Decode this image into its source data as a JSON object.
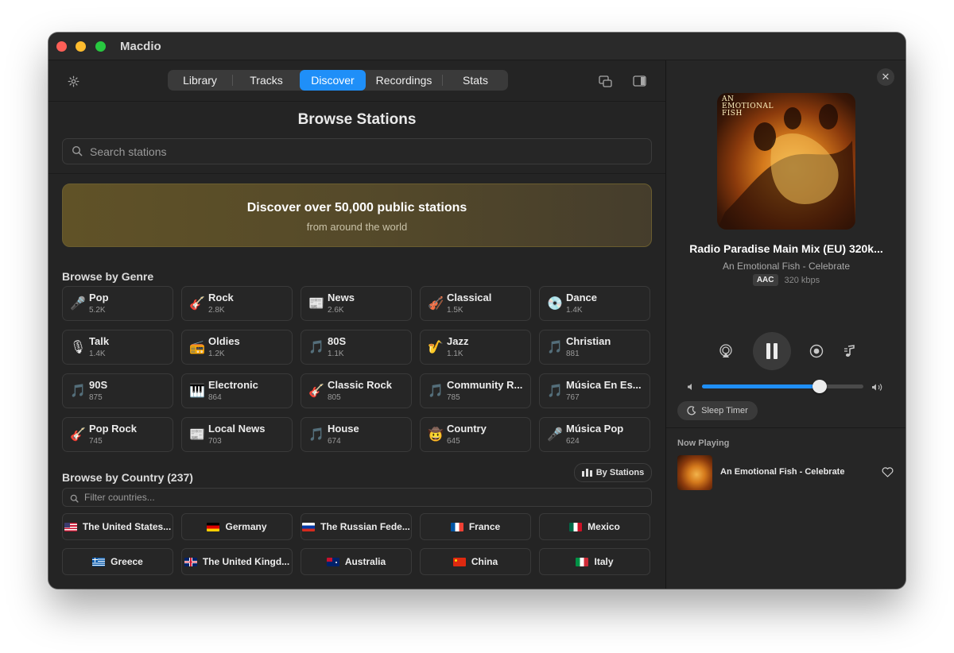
{
  "app": {
    "title": "Macdio"
  },
  "toolbar": {
    "tabs": [
      {
        "label": "Library",
        "active": false
      },
      {
        "label": "Tracks",
        "active": false
      },
      {
        "label": "Discover",
        "active": true
      },
      {
        "label": "Recordings",
        "active": false
      },
      {
        "label": "Stats",
        "active": false
      }
    ],
    "icons": {
      "settings": "gear-icon",
      "miniplayer": "mini-player-icon",
      "sidebar": "sidebar-toggle-icon"
    }
  },
  "browse": {
    "heading": "Browse Stations",
    "search_placeholder": "Search stations",
    "banner": {
      "title": "Discover over 50,000 public stations",
      "subtitle": "from around the world"
    }
  },
  "genres": {
    "title": "Browse by Genre",
    "items": [
      {
        "name": "Pop",
        "count": "5.2K",
        "icon": "🎤"
      },
      {
        "name": "Rock",
        "count": "2.8K",
        "icon": "🎸"
      },
      {
        "name": "News",
        "count": "2.6K",
        "icon": "📰"
      },
      {
        "name": "Classical",
        "count": "1.5K",
        "icon": "🎻"
      },
      {
        "name": "Dance",
        "count": "1.4K",
        "icon": "💿"
      },
      {
        "name": "Talk",
        "count": "1.4K",
        "icon": "🎙"
      },
      {
        "name": "Oldies",
        "count": "1.2K",
        "icon": "📻"
      },
      {
        "name": "80S",
        "count": "1.1K",
        "icon": "🎵"
      },
      {
        "name": "Jazz",
        "count": "1.1K",
        "icon": "🎷"
      },
      {
        "name": "Christian",
        "count": "881",
        "icon": "🎵"
      },
      {
        "name": "90S",
        "count": "875",
        "icon": "🎵"
      },
      {
        "name": "Electronic",
        "count": "864",
        "icon": "🎹"
      },
      {
        "name": "Classic Rock",
        "count": "805",
        "icon": "🎸"
      },
      {
        "name": "Community R...",
        "count": "785",
        "icon": "🎵"
      },
      {
        "name": "Música En Es...",
        "count": "767",
        "icon": "🎵"
      },
      {
        "name": "Pop Rock",
        "count": "745",
        "icon": "🎸"
      },
      {
        "name": "Local News",
        "count": "703",
        "icon": "📰"
      },
      {
        "name": "House",
        "count": "674",
        "icon": "🎵"
      },
      {
        "name": "Country",
        "count": "645",
        "icon": "🤠"
      },
      {
        "name": "Música Pop",
        "count": "624",
        "icon": "🎤"
      }
    ]
  },
  "countries": {
    "title": "Browse by Country (237)",
    "sort_label": "By Stations",
    "filter_placeholder": "Filter countries...",
    "items": [
      {
        "name": "The United States...",
        "flag": "us"
      },
      {
        "name": "Germany",
        "flag": "de"
      },
      {
        "name": "The Russian Fede...",
        "flag": "ru"
      },
      {
        "name": "France",
        "flag": "fr"
      },
      {
        "name": "Mexico",
        "flag": "mx"
      },
      {
        "name": "Greece",
        "flag": "gr"
      },
      {
        "name": "The United Kingd...",
        "flag": "gb"
      },
      {
        "name": "Australia",
        "flag": "au"
      },
      {
        "name": "China",
        "flag": "cn"
      },
      {
        "name": "Italy",
        "flag": "it"
      }
    ]
  },
  "player": {
    "station": "Radio Paradise Main Mix (EU) 320k...",
    "track": "An Emotional Fish - Celebrate",
    "codec": "AAC",
    "bitrate": "320 kbps",
    "album_art_text": "AN EMOTIONAL FISH",
    "volume": 0.73,
    "sleep_timer_label": "Sleep Timer",
    "now_playing_title": "Now Playing",
    "now_playing_item": "An Emotional Fish - Celebrate",
    "accent": "#1f8ff8"
  }
}
